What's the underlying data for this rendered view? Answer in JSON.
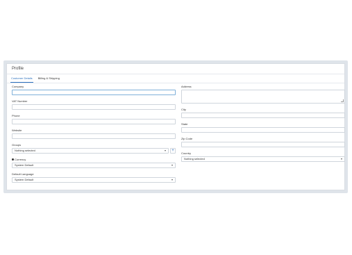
{
  "panel": {
    "title": "Profile"
  },
  "tabs": [
    {
      "label": "Customer Details",
      "active": true
    },
    {
      "label": "Billing & Shipping",
      "active": false
    }
  ],
  "left": {
    "company": {
      "label": "Company",
      "value": ""
    },
    "vat": {
      "label": "VAT Number",
      "value": ""
    },
    "phone": {
      "label": "Phone",
      "value": ""
    },
    "website": {
      "label": "Website",
      "value": ""
    },
    "groups": {
      "label": "Groups",
      "value": "Nothing selected",
      "add_label": "+"
    },
    "currency": {
      "label": "Currency",
      "value": "System Default"
    },
    "language": {
      "label": "Default Language",
      "value": "System Default"
    }
  },
  "right": {
    "address": {
      "label": "Address",
      "value": ""
    },
    "city": {
      "label": "City",
      "value": ""
    },
    "state": {
      "label": "State",
      "value": ""
    },
    "zip": {
      "label": "Zip Code",
      "value": ""
    },
    "country": {
      "label": "Country",
      "value": "Nothing selected"
    }
  },
  "colors": {
    "accent": "#2a6fbd",
    "frame": "#dfe4ea",
    "border": "#cfd5dc"
  },
  "icons": {
    "currency_help": "question-circle-icon",
    "select_caret": "caret-down-icon",
    "add": "plus-icon"
  }
}
